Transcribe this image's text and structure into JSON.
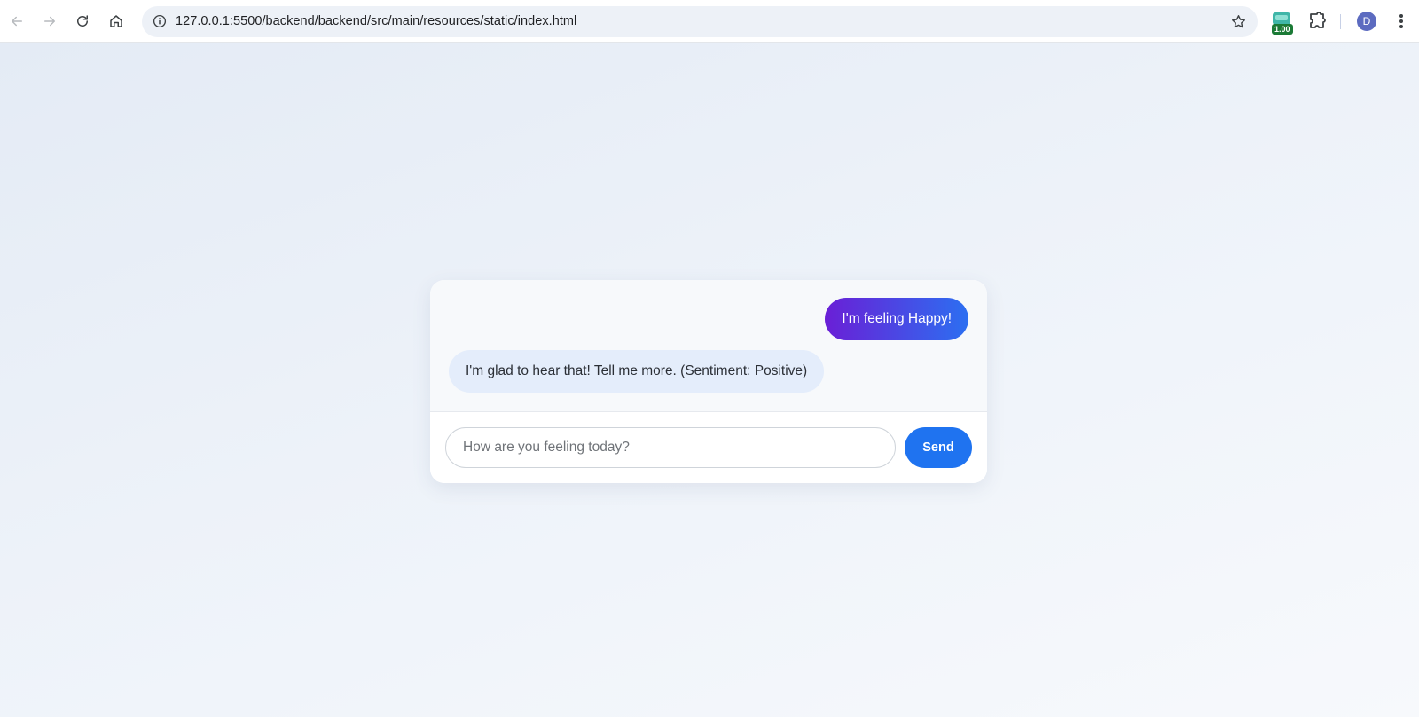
{
  "browser": {
    "url": "127.0.0.1:5500/backend/backend/src/main/resources/static/index.html",
    "extension_badge": "1.00",
    "profile_initial": "D",
    "icons": {
      "back": "arrow-left-icon",
      "forward": "arrow-right-icon",
      "reload": "reload-icon",
      "home": "home-icon",
      "site_info": "info-icon",
      "bookmark": "star-icon",
      "extension": "extension-icon",
      "extensions_menu": "puzzle-icon",
      "menu": "kebab-menu-icon"
    }
  },
  "chat": {
    "messages": [
      {
        "sender": "user",
        "text": "I'm feeling Happy!"
      },
      {
        "sender": "bot",
        "text": "I'm glad to hear that! Tell me more. (Sentiment: Positive)"
      }
    ],
    "input": {
      "value": "",
      "placeholder": "How are you feeling today?"
    },
    "send_label": "Send"
  },
  "colors": {
    "user_bubble_start": "#6a1fd6",
    "user_bubble_end": "#2c6ff1",
    "bot_bubble": "#e4edfb",
    "send_button": "#1f73f0",
    "extension_badge": "#1b7a36",
    "avatar": "#5c6bc0"
  }
}
